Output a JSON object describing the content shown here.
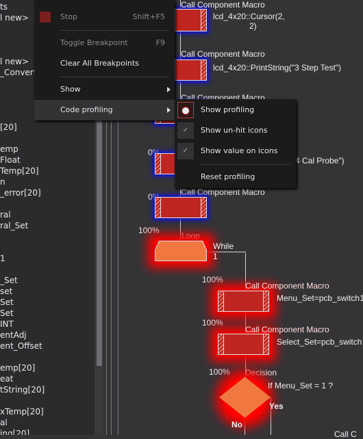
{
  "left_panel": {
    "items": [
      "ts",
      "l new>",
      "l new>",
      "_Convert",
      "[20]",
      "emp",
      "Float",
      "Temp[20]",
      "n",
      "_error[20]",
      "ral",
      "ral_Set",
      "1",
      "_Set",
      "set",
      "Set",
      "Set",
      "INT",
      "entAdj",
      "ent_Offset",
      "emp[20]",
      "eat",
      "tString[20]",
      "xTemp[20]",
      "al",
      "ing[20]"
    ]
  },
  "context_menu": {
    "stop": {
      "label": "Stop",
      "shortcut": "Shift+F5",
      "icon": "stop-icon",
      "enabled": false
    },
    "toggle_breakpoint": {
      "label": "Toggle Breakpoint",
      "shortcut": "F9",
      "enabled": false
    },
    "clear_breakpoints": {
      "label": "Clear All Breakpoints"
    },
    "show": {
      "label": "Show"
    },
    "code_profiling": {
      "label": "Code profiling"
    }
  },
  "submenu": {
    "show_profiling": {
      "label": "Show profiling",
      "icon": "ladybug-icon"
    },
    "show_unhit": {
      "label": "Show un-hit icons",
      "checked": true
    },
    "show_value": {
      "label": "Show value on icons",
      "checked": true
    },
    "reset": {
      "label": "Reset profiling"
    }
  },
  "flowchart": {
    "b1": {
      "title": "Call Component Macro",
      "text1": "lcd_4x20::Cursor(2,",
      "text2": "2)"
    },
    "b2": {
      "title": "Call Component Macro",
      "text": "lcd_4x20::PrintString(\"3 Step Test\")"
    },
    "b3": {
      "title": "Call Component Macro"
    },
    "b4": {
      "pct": "0%",
      "text": "4 Cal Probe\")"
    },
    "b5": {
      "pct": "0%",
      "title": "Call Component Macro"
    },
    "loop": {
      "pct": "100%",
      "title": "Loop",
      "cond1": "While",
      "cond2": "1"
    },
    "b6": {
      "pct": "100%",
      "title": "Call Component Macro",
      "text": "Menu_Set=pcb_switch1"
    },
    "b7": {
      "pct": "100%",
      "title": "Call Component Macro",
      "text": "Select_Set=pcb_switch"
    },
    "dec": {
      "pct": "100%",
      "title": "Decision",
      "text": "If  Menu_Set = 1 ?",
      "yes": "Yes",
      "no": "No"
    },
    "b8": {
      "title": "Call C"
    }
  },
  "colors": {
    "hit": "#ff0000",
    "unhit": "#1010e0",
    "icon_red": "#bf2622",
    "icon_orange": "#f07840"
  }
}
